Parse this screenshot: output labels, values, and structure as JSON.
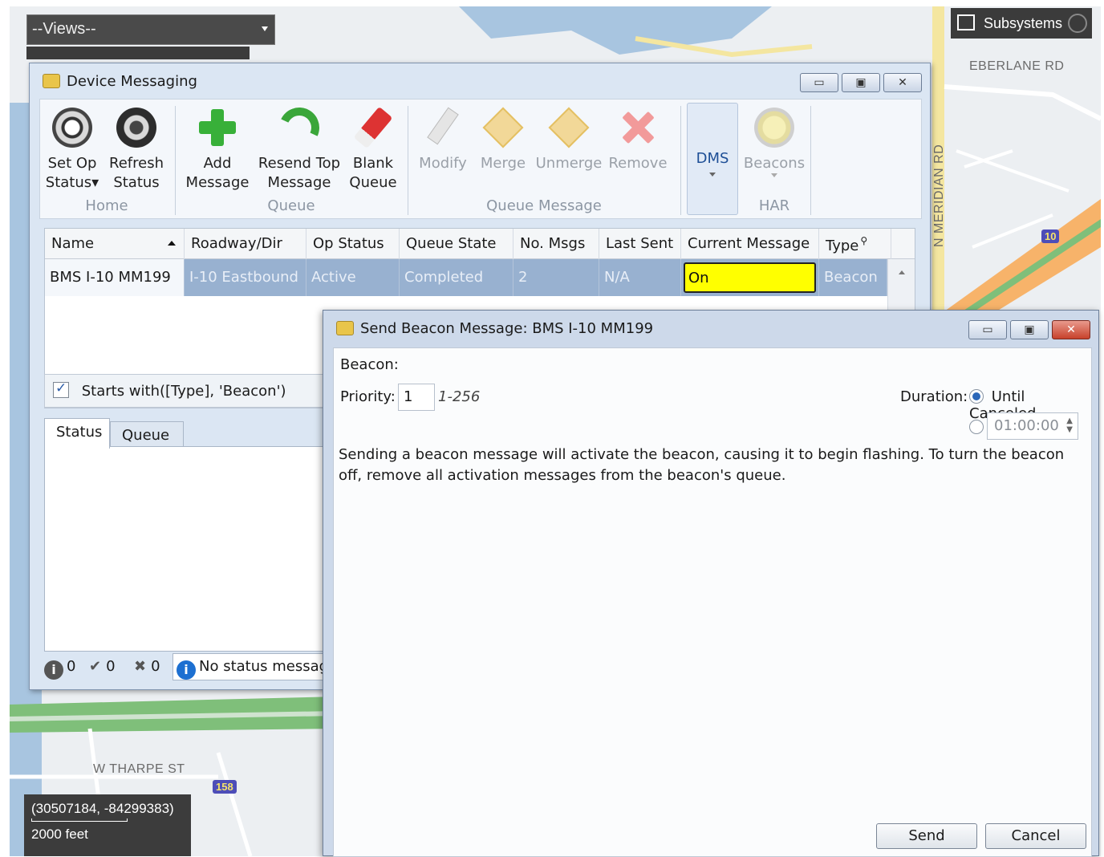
{
  "map": {
    "views_label": "--Views--",
    "subsystems_label": "Subsystems",
    "road_labels": [
      "EBERLANE RD",
      "N MERIDIAN RD",
      "W THARPE ST"
    ],
    "shields": [
      "10",
      "158"
    ],
    "coordinates": "(30507184, -84299383)",
    "scale": "2000 feet"
  },
  "device_messaging": {
    "title": "Device Messaging",
    "window_buttons": [
      "▭",
      "▣",
      "✕"
    ],
    "ribbon": {
      "groups": [
        "Home",
        "Queue",
        "Queue Message",
        "HAR"
      ],
      "buttons": {
        "set_op_status": [
          "Set Op",
          "Status"
        ],
        "refresh_status": [
          "Refresh",
          "Status"
        ],
        "add_message": [
          "Add",
          "Message"
        ],
        "resend_top": [
          "Resend Top",
          "Message"
        ],
        "blank_queue": [
          "Blank",
          "Queue"
        ],
        "modify": "Modify",
        "merge": "Merge",
        "unmerge": "Unmerge",
        "remove": "Remove",
        "dms": "DMS",
        "beacons": "Beacons"
      }
    },
    "grid": {
      "columns": [
        "Name",
        "Roadway/Dir",
        "Op Status",
        "Queue State",
        "No. Msgs",
        "Last Sent",
        "Current Message",
        "Type"
      ],
      "rows": [
        {
          "name": "BMS I-10 MM199",
          "roadway": "I-10 Eastbound",
          "op_status": "Active",
          "queue_state": "Completed",
          "no_msgs": "2",
          "last_sent": "N/A",
          "current_message": "On",
          "type": "Beacon"
        }
      ],
      "highlight_color": "#ffff00"
    },
    "filter": "Starts with([Type], 'Beacon')",
    "tabs": [
      "Status",
      "Queue"
    ],
    "status_bar": {
      "info_count": "0",
      "ok_count": "0",
      "error_count": "0",
      "message": "No status message"
    }
  },
  "beacon_dialog": {
    "title": "Send Beacon Message: BMS I-10 MM199",
    "window_buttons": [
      "▭",
      "▣",
      "✕"
    ],
    "beacon_label": "Beacon:",
    "priority_label": "Priority:",
    "priority_value": "1",
    "priority_range": "1-256",
    "duration_label": "Duration:",
    "until_canceled_label": "Until Canceled",
    "until_canceled_selected": true,
    "duration_time": "01:00:00",
    "info": "Sending a beacon message will activate the beacon, causing it to begin flashing. To turn the beacon off, remove all activation messages from the beacon's queue.",
    "send_label": "Send",
    "cancel_label": "Cancel"
  },
  "colors": {
    "selection_row": "#98b1d0",
    "current_message_bg": "#ffff00",
    "window_frame": "#dbe6f3"
  }
}
